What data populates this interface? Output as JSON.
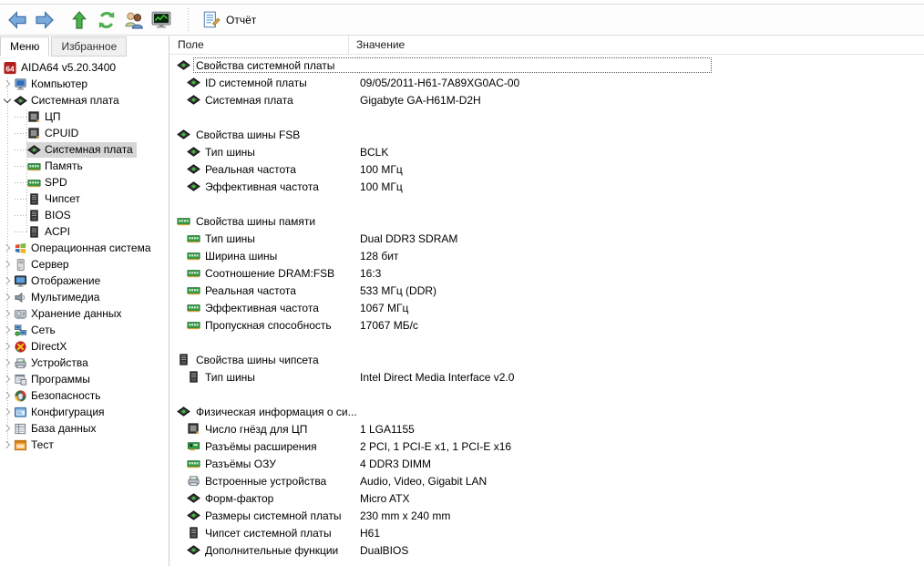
{
  "window": {
    "app_title": "AIDA64"
  },
  "colors": {
    "selection_bg": "#d6d6d6",
    "focus_outline": "#595959",
    "ram_green": "#2f9e44",
    "aida_red": "#b01e1e"
  },
  "toolbar": {
    "report_label": "Отчёт",
    "buttons": [
      "back",
      "forward",
      "up",
      "refresh",
      "users",
      "system-monitor"
    ]
  },
  "sidebar": {
    "tabs": [
      {
        "label": "Меню",
        "active": true
      },
      {
        "label": "Избранное",
        "active": false
      }
    ],
    "tree": [
      {
        "label": "AIDA64 v5.20.3400",
        "icon": "aida64",
        "level": 0
      },
      {
        "label": "Компьютер",
        "icon": "computer",
        "level": 1,
        "expander": "collapsed"
      },
      {
        "label": "Системная плата",
        "icon": "motherboard",
        "level": 1,
        "expander": "expanded"
      },
      {
        "label": "ЦП",
        "icon": "cpu",
        "level": 2
      },
      {
        "label": "CPUID",
        "icon": "cpu",
        "level": 2
      },
      {
        "label": "Системная плата",
        "icon": "motherboard",
        "level": 2,
        "selected": true
      },
      {
        "label": "Память",
        "icon": "ram",
        "level": 2
      },
      {
        "label": "SPD",
        "icon": "ram",
        "level": 2
      },
      {
        "label": "Чипсет",
        "icon": "chip",
        "level": 2
      },
      {
        "label": "BIOS",
        "icon": "chip",
        "level": 2
      },
      {
        "label": "ACPI",
        "icon": "chip",
        "level": 2
      },
      {
        "label": "Операционная система",
        "icon": "windows",
        "level": 1,
        "expander": "collapsed"
      },
      {
        "label": "Сервер",
        "icon": "server",
        "level": 1,
        "expander": "collapsed"
      },
      {
        "label": "Отображение",
        "icon": "display",
        "level": 1,
        "expander": "collapsed"
      },
      {
        "label": "Мультимедиа",
        "icon": "multimedia",
        "level": 1,
        "expander": "collapsed"
      },
      {
        "label": "Хранение данных",
        "icon": "storage",
        "level": 1,
        "expander": "collapsed"
      },
      {
        "label": "Сеть",
        "icon": "network",
        "level": 1,
        "expander": "collapsed"
      },
      {
        "label": "DirectX",
        "icon": "directx",
        "level": 1,
        "expander": "collapsed"
      },
      {
        "label": "Устройства",
        "icon": "devices",
        "level": 1,
        "expander": "collapsed"
      },
      {
        "label": "Программы",
        "icon": "programs",
        "level": 1,
        "expander": "collapsed"
      },
      {
        "label": "Безопасность",
        "icon": "security",
        "level": 1,
        "expander": "collapsed"
      },
      {
        "label": "Конфигурация",
        "icon": "config",
        "level": 1,
        "expander": "collapsed"
      },
      {
        "label": "База данных",
        "icon": "database",
        "level": 1,
        "expander": "collapsed"
      },
      {
        "label": "Тест",
        "icon": "test",
        "level": 1,
        "expander": "collapsed"
      }
    ]
  },
  "main": {
    "columns": [
      "Поле",
      "Значение"
    ],
    "sections": [
      {
        "title": "Свойства системной платы",
        "icon": "motherboard",
        "focused": true,
        "rows": [
          {
            "field": "ID системной платы",
            "value": "09/05/2011-H61-7A89XG0AC-00",
            "icon": "motherboard"
          },
          {
            "field": "Системная плата",
            "value": "Gigabyte GA-H61M-D2H",
            "icon": "motherboard"
          }
        ]
      },
      {
        "title": "Свойства шины FSB",
        "icon": "motherboard",
        "rows": [
          {
            "field": "Тип шины",
            "value": "BCLK",
            "icon": "motherboard"
          },
          {
            "field": "Реальная частота",
            "value": "100 МГц",
            "icon": "motherboard"
          },
          {
            "field": "Эффективная частота",
            "value": "100 МГц",
            "icon": "motherboard"
          }
        ]
      },
      {
        "title": "Свойства шины памяти",
        "icon": "ram",
        "rows": [
          {
            "field": "Тип шины",
            "value": "Dual DDR3 SDRAM",
            "icon": "ram"
          },
          {
            "field": "Ширина шины",
            "value": "128 бит",
            "icon": "ram"
          },
          {
            "field": "Соотношение DRAM:FSB",
            "value": "16:3",
            "icon": "ram"
          },
          {
            "field": "Реальная частота",
            "value": "533 МГц (DDR)",
            "icon": "ram"
          },
          {
            "field": "Эффективная частота",
            "value": "1067 МГц",
            "icon": "ram"
          },
          {
            "field": "Пропускная способность",
            "value": "17067 МБ/с",
            "icon": "ram"
          }
        ]
      },
      {
        "title": "Свойства шины чипсета",
        "icon": "chip",
        "rows": [
          {
            "field": "Тип шины",
            "value": "Intel Direct Media Interface v2.0",
            "icon": "chip"
          }
        ]
      },
      {
        "title": "Физическая информация о си...",
        "icon": "motherboard",
        "rows": [
          {
            "field": "Число гнёзд для ЦП",
            "value": "1 LGA1155",
            "icon": "cpu"
          },
          {
            "field": "Разъёмы расширения",
            "value": "2 PCI, 1 PCI-E x1, 1 PCI-E x16",
            "icon": "expansion"
          },
          {
            "field": "Разъёмы ОЗУ",
            "value": "4 DDR3 DIMM",
            "icon": "ram"
          },
          {
            "field": "Встроенные устройства",
            "value": "Audio, Video, Gigabit LAN",
            "icon": "devices"
          },
          {
            "field": "Форм-фактор",
            "value": "Micro ATX",
            "icon": "motherboard"
          },
          {
            "field": "Размеры системной платы",
            "value": "230 mm x 240 mm",
            "icon": "motherboard"
          },
          {
            "field": "Чипсет системной платы",
            "value": "H61",
            "icon": "chip"
          },
          {
            "field": "Дополнительные функции",
            "value": "DualBIOS",
            "icon": "motherboard"
          }
        ]
      }
    ]
  }
}
